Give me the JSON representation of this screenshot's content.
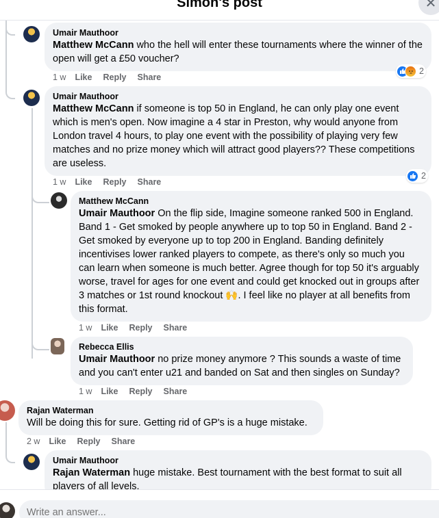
{
  "header": {
    "title": "Simon's post",
    "close_icon": "close-icon"
  },
  "comments": [
    {
      "author": "Umair Mauthoor",
      "mention": "Matthew McCann",
      "text": " who the hell will enter these tournaments where the winner of the open will get a £50 voucher?",
      "time": "1 w",
      "like": "Like",
      "reply": "Reply",
      "share": "Share",
      "reactions": {
        "types": [
          "like",
          "angry"
        ],
        "count": "2"
      }
    },
    {
      "author": "Umair Mauthoor",
      "mention": "Matthew McCann",
      "text": " if someone is top 50 in England, he can only play one event which is men's open. Now imagine a 4 star in Preston, why would anyone from London travel 4 hours, to play one event with the possibility of playing very few matches and no prize money which will attract good players?? These competitions are useless.",
      "time": "1 w",
      "like": "Like",
      "reply": "Reply",
      "share": "Share",
      "reactions": {
        "types": [
          "like"
        ],
        "count": "2"
      }
    },
    {
      "author": "Matthew McCann",
      "mention": "Umair Mauthoor",
      "text": " On the flip side, Imagine someone ranked 500 in England. Band 1 - Get smoked by people anywhere up to top 50 in England. Band 2 - Get smoked by everyone up to top 200 in England. Banding definitely incentivises lower ranked players to compete, as there's only so much you can learn when someone is much better. Agree though for top 50 it's arguably worse, travel for ages for one event and could get knocked out in groups after 3 matches or 1st round knockout 🙌. I feel like no player at all benefits from this format.",
      "time": "1 w",
      "like": "Like",
      "reply": "Reply",
      "share": "Share"
    },
    {
      "author": "Rebecca Ellis",
      "mention": "Umair Mauthoor",
      "text": " no prize money anymore ? This sounds a waste of time and you can't enter u21 and banded on Sat and then singles on Sunday?",
      "time": "1 w",
      "like": "Like",
      "reply": "Reply",
      "share": "Share"
    },
    {
      "author": "Rajan Waterman",
      "mention": "",
      "text": "Will be doing this for sure. Getting rid of GP's is a huge mistake.",
      "time": "2 w",
      "like": "Like",
      "reply": "Reply",
      "share": "Share"
    },
    {
      "author": "Umair Mauthoor",
      "mention": "Rajan Waterman",
      "text": " huge mistake. Best tournament with the best format to suit all players of all levels."
    }
  ],
  "footer": {
    "placeholder": "Write an answer..."
  }
}
